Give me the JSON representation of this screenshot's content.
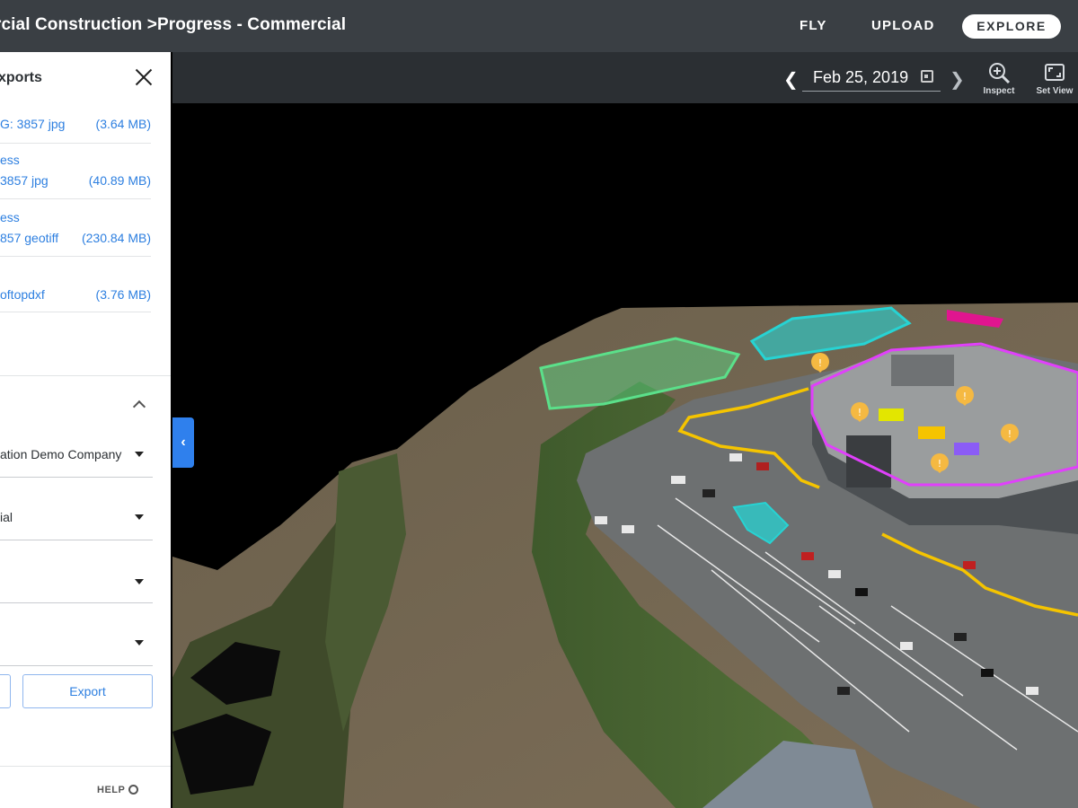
{
  "topbar": {
    "breadcrumb": "rcial Construction >Progress - Commercial",
    "nav": {
      "fly": "FLY",
      "upload": "UPLOAD",
      "explore": "EXPLORE"
    }
  },
  "toolbar": {
    "date": "Feb 25, 2019",
    "tools": {
      "inspect": "Inspect",
      "set_view": "Set View"
    },
    "icons": [
      "chevron-left-icon",
      "calendar-icon",
      "chevron-right-icon",
      "zoom-icon",
      "frame-icon"
    ]
  },
  "panel": {
    "title": "xports",
    "exports": [
      {
        "line1": "G: 3857 jpg",
        "line2": "",
        "size": "(3.64 MB)"
      },
      {
        "line1": "ess",
        "line2": "3857 jpg",
        "size": "(40.89 MB)"
      },
      {
        "line1": "ess",
        "line2": "857 geotiff",
        "size": "(230.84 MB)"
      },
      {
        "line1": "",
        "line2": "oftopdxf",
        "size": "(3.76 MB)"
      }
    ],
    "fields": {
      "company": "ation Demo Company",
      "project": "ial",
      "field3": "",
      "field4": ""
    },
    "export_button": "Export",
    "help": "HELP"
  },
  "colors": {
    "topbar": "#3a3f44",
    "subbar": "#2b2f33",
    "accent_blue": "#2d7fe0",
    "toggle_blue": "#2f80ed",
    "outline_magenta": "#e040fb",
    "outline_yellow": "#f5c400",
    "outline_cyan": "#27d3d3",
    "outline_green": "#5be08a"
  }
}
